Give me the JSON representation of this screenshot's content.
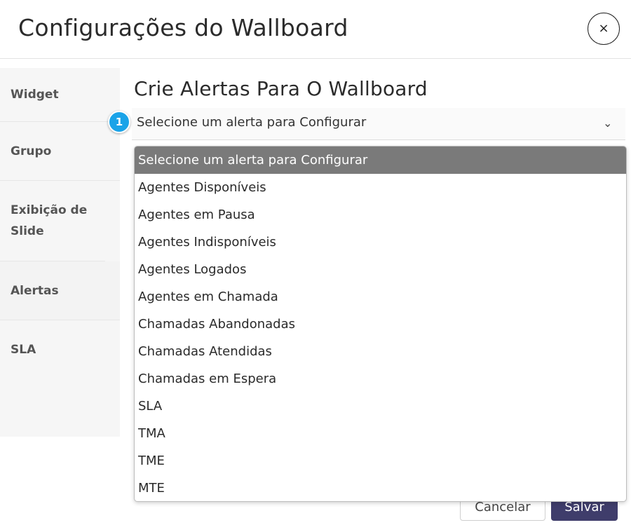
{
  "header": {
    "title": "Configurações do Wallboard",
    "close_icon": "×"
  },
  "sidebar": {
    "items": [
      {
        "label": "Widget"
      },
      {
        "label": "Grupo"
      },
      {
        "label": "Exibição de Slide"
      },
      {
        "label": "Alertas"
      },
      {
        "label": "SLA"
      }
    ]
  },
  "main": {
    "heading": "Crie Alertas Para O Wallboard",
    "step_badge": "1",
    "select": {
      "value": "Selecione um alerta para Configurar",
      "chevron": "⌄",
      "options": [
        "Selecione um alerta para Configurar",
        "Agentes Disponíveis",
        "Agentes em Pausa",
        "Agentes Indisponíveis",
        "Agentes Logados",
        "Agentes em Chamada",
        "Chamadas Abandonadas",
        "Chamadas Atendidas",
        "Chamadas em Espera",
        "SLA",
        "TMA",
        "TME",
        "MTE"
      ]
    }
  },
  "footer": {
    "cancel_label": "Cancelar",
    "save_label": "Salvar"
  },
  "colors": {
    "badge": "#1aa3e8",
    "save_button": "#3f3d6b",
    "selected_option": "#7a7a7a"
  }
}
